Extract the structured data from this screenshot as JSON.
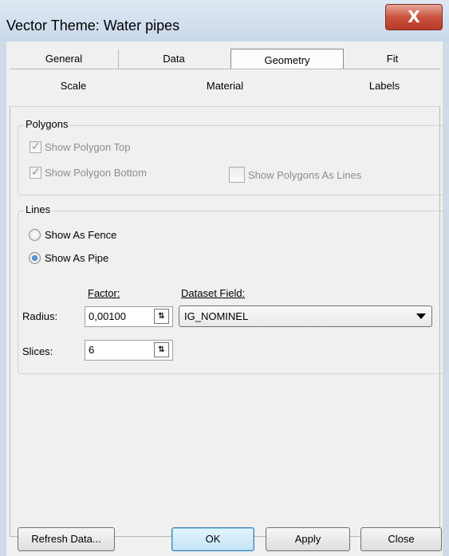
{
  "window": {
    "title": "Vector Theme: Water pipes",
    "close_label": "X"
  },
  "tabs_row1": [
    {
      "label": "General"
    },
    {
      "label": "Data"
    },
    {
      "label": "Geometry"
    },
    {
      "label": "Fit"
    }
  ],
  "tabs_row2": [
    {
      "label": "Scale"
    },
    {
      "label": "Material"
    },
    {
      "label": "Labels"
    }
  ],
  "active_tab": "Geometry",
  "polygons": {
    "group_label": "Polygons",
    "show_top": {
      "label": "Show Polygon Top",
      "checked": true,
      "enabled": false
    },
    "show_bottom": {
      "label": "Show Polygon Bottom",
      "checked": true,
      "enabled": false
    },
    "as_lines": {
      "label": "Show Polygons As Lines",
      "checked": false,
      "enabled": false
    }
  },
  "lines": {
    "group_label": "Lines",
    "fence": {
      "label": "Show As Fence",
      "selected": false
    },
    "pipe": {
      "label": "Show As Pipe",
      "selected": true
    },
    "factor_header": "Factor:",
    "dataset_field_header": "Dataset Field:",
    "radius": {
      "label": "Radius:",
      "value": "0,00100",
      "field": "IG_NOMINEL"
    },
    "slices": {
      "label": "Slices:",
      "value": "6"
    }
  },
  "buttons": {
    "refresh": "Refresh Data...",
    "ok": "OK",
    "apply": "Apply",
    "close": "Close"
  }
}
